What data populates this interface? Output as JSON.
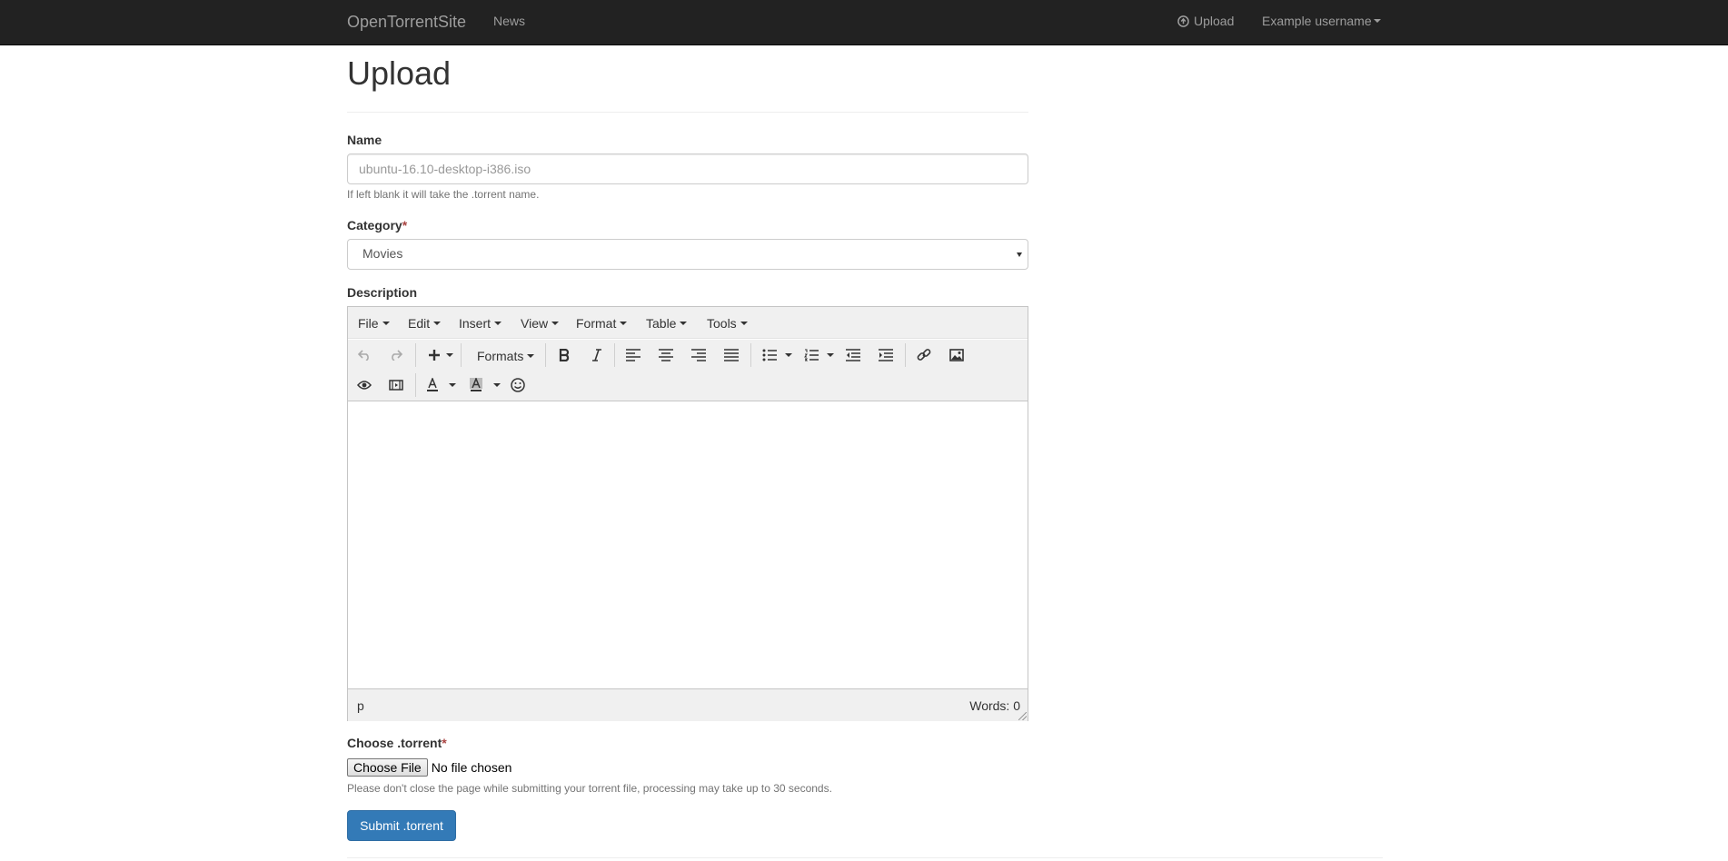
{
  "navbar": {
    "brand": "OpenTorrentSite",
    "news": "News",
    "upload": "Upload",
    "user": "Example username"
  },
  "page": {
    "title": "Upload"
  },
  "form": {
    "name": {
      "label": "Name",
      "value": "",
      "placeholder": "ubuntu-16.10-desktop-i386.iso",
      "help": "If left blank it will take the .torrent name."
    },
    "category": {
      "label": "Category",
      "required_mark": "*",
      "selected": "Movies"
    },
    "description": {
      "label": "Description",
      "menus": [
        "File",
        "Edit",
        "Insert",
        "View",
        "Format",
        "Table",
        "Tools"
      ],
      "formats_label": "Formats",
      "status_path": "p",
      "word_count": "Words: 0"
    },
    "torrent": {
      "label": "Choose .torrent",
      "required_mark": "*",
      "button": "Choose File",
      "status": "No file chosen",
      "help": "Please don't close the page while submitting your torrent file, processing may take up to 30 seconds."
    },
    "submit": "Submit .torrent"
  },
  "colors": {
    "navbar_bg": "#222222",
    "navbar_text": "#9d9d9d",
    "primary_button": "#337ab7",
    "required": "#a94442"
  }
}
